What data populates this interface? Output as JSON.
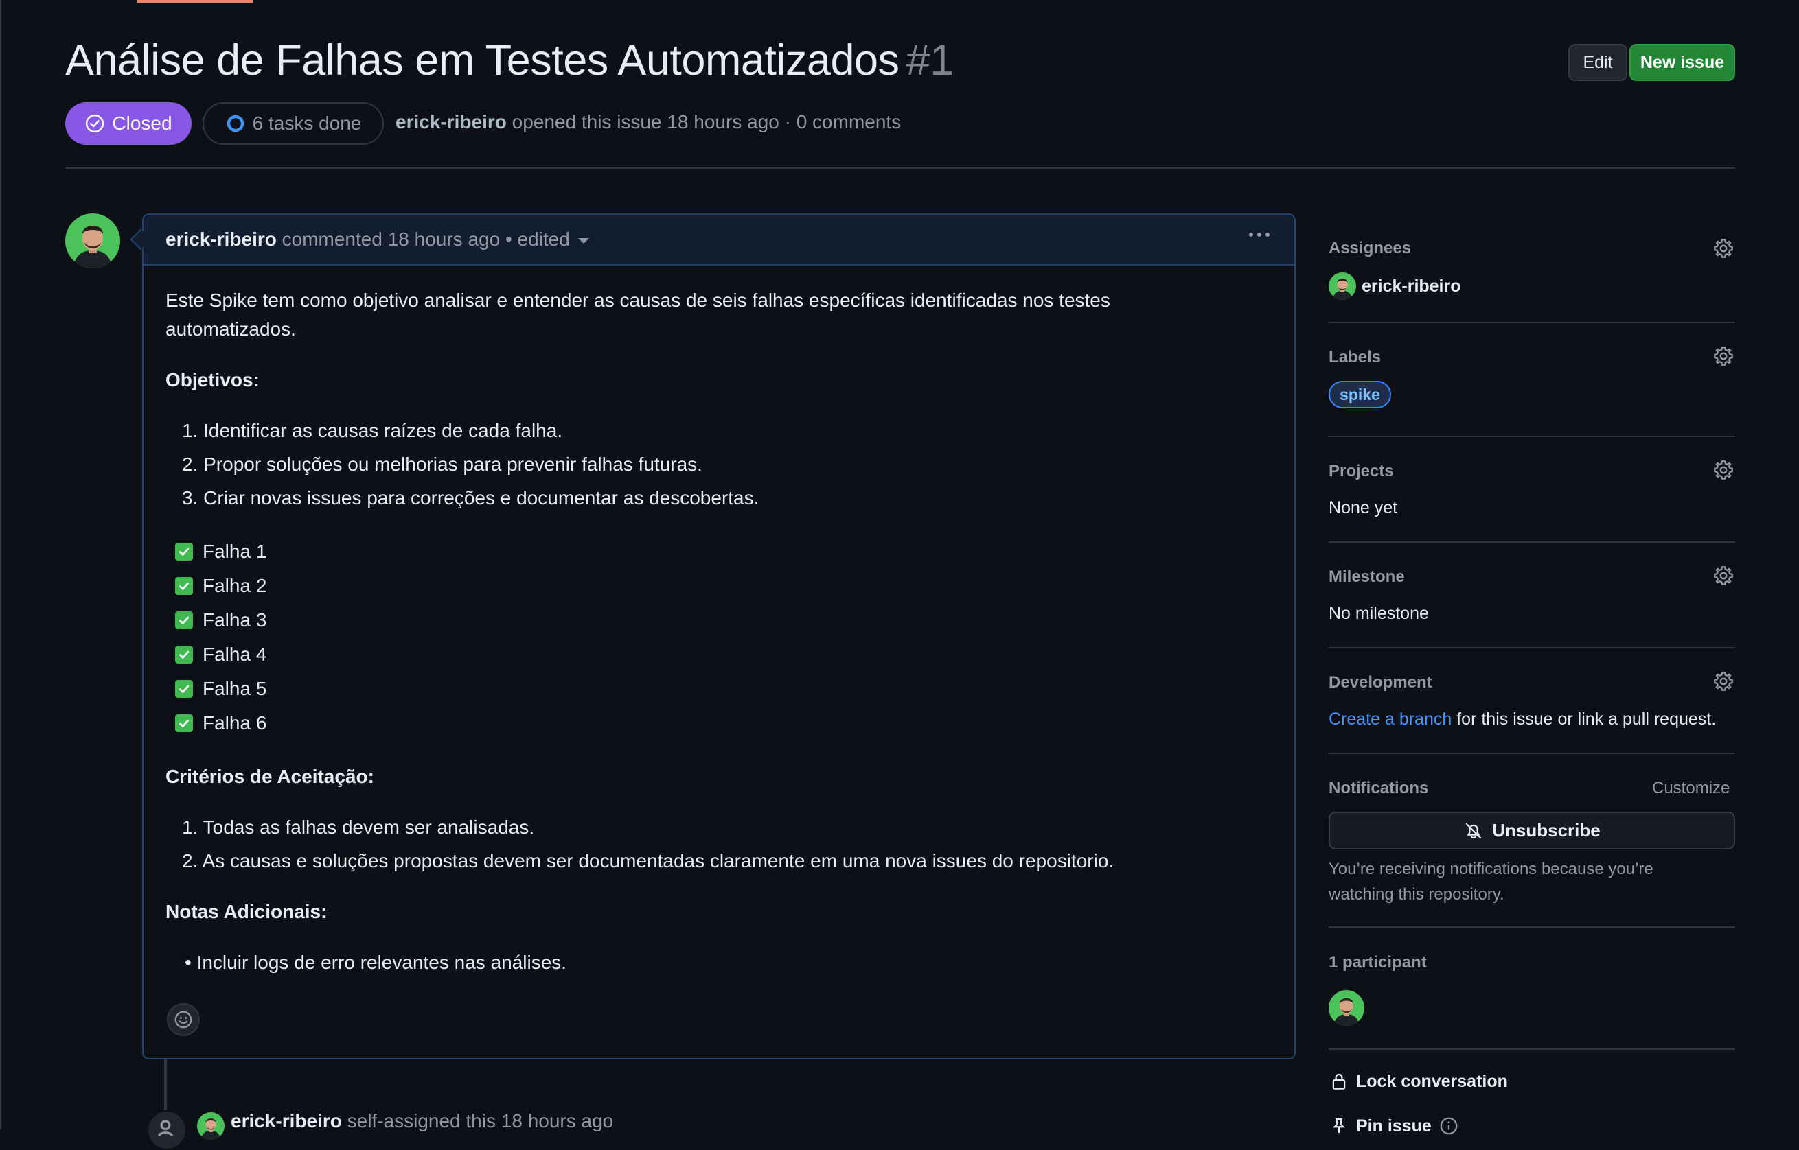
{
  "issue": {
    "title": "Análise de Falhas em Testes Automatizados",
    "number": "#1",
    "status": "Closed",
    "tasks": "6 tasks done",
    "author": "erick-ribeiro",
    "opened_text": "opened this issue 18 hours ago · 0 comments"
  },
  "header_buttons": {
    "edit": "Edit",
    "new_issue": "New issue"
  },
  "comment": {
    "author": "erick-ribeiro",
    "meta": "commented 18 hours ago • edited",
    "intro_line1": "Este Spike tem como objetivo analisar e entender as causas de seis falhas específicas identificadas nos testes",
    "intro_line2": "automatizados.",
    "objetivos_heading": "Objetivos:",
    "objetivos": [
      "1. Identificar as causas raízes de cada falha.",
      "2. Propor soluções ou melhorias para prevenir falhas futuras.",
      "3. Criar novas issues para correções e documentar as descobertas."
    ],
    "tasks": [
      "Falha 1",
      "Falha 2",
      "Falha 3",
      "Falha 4",
      "Falha 5",
      "Falha 6"
    ],
    "criterios_heading": "Critérios de Aceitação:",
    "criterios": [
      "1. Todas as falhas devem ser analisadas.",
      "2. As causas e soluções propostas devem ser documentadas claramente em uma nova issues do repositorio."
    ],
    "notas_heading": "Notas Adicionais:",
    "notas": [
      "•  Incluir logs de erro relevantes nas análises."
    ]
  },
  "timeline": {
    "author": "erick-ribeiro",
    "event": "self-assigned this 18 hours ago"
  },
  "sidebar": {
    "assignees": {
      "heading": "Assignees",
      "value": "erick-ribeiro"
    },
    "labels": {
      "heading": "Labels",
      "value": "spike"
    },
    "projects": {
      "heading": "Projects",
      "value": "None yet"
    },
    "milestone": {
      "heading": "Milestone",
      "value": "No milestone"
    },
    "development": {
      "heading": "Development",
      "link": "Create a branch",
      "rest": "for this issue or link a pull request."
    },
    "notifications": {
      "heading": "Notifications",
      "customize": "Customize",
      "button": "Unsubscribe",
      "text": "You’re receiving notifications because you’re watching this repository."
    },
    "participants": {
      "heading": "1 participant"
    },
    "lock": "Lock conversation",
    "pin": "Pin issue"
  },
  "colors": {
    "background": "#0d1117",
    "closed": "#8957e5",
    "new_issue": "#238636",
    "link": "#4493f8",
    "check": "#3fb950"
  }
}
